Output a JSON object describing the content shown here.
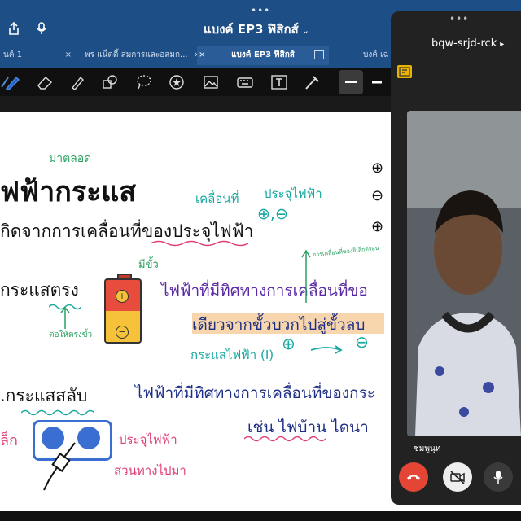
{
  "header": {
    "title": "แบงค์ EP3 ฟิสิกส์",
    "dots": "•••"
  },
  "tabs": [
    {
      "label": "นค์ 1",
      "close": "×"
    },
    {
      "label": "พร แน็ตตี้ สมการและอสมก...",
      "close": "×"
    },
    {
      "label": "แบงค์ EP3 ฟิสิกส์",
      "close": "×"
    },
    {
      "label": "บงค์ เฉ",
      "close": ""
    }
  ],
  "toolbar": {
    "tools": [
      "lasso-icon",
      "pen-icon",
      "eraser-icon",
      "highlighter-icon",
      "shapes-icon",
      "lasso-select-icon",
      "sticker-icon",
      "image-icon",
      "keyboard-icon",
      "text-icon",
      "pointer-icon",
      "thin-line-icon",
      "thick-line-icon"
    ]
  },
  "notes": {
    "title_small": "มาตลอด",
    "title": "ฟฟ้ากระแส",
    "line1": "กิดจากการเคลื่อนที่ของประจุไฟฟ้า",
    "moving": "เคลื่อนที่",
    "charge": "ประจุไฟฟ้า",
    "charge_signs": "⊕,⊖",
    "dc_heading": "กระแสตรง",
    "has_poles": "มีขั้ว",
    "connect_poles": "ต่อให้ตรงขั้ว",
    "dc_desc": "ไฟฟ้าที่มีทิศทางการเคลื่อนที่ขอ",
    "one_direction": "เดียวจากขั้วบวกไปสู่ขั้วลบ",
    "current_label": "กระแสไฟฟ้า (I)",
    "plus_circle": "⊕",
    "minus_circle": "⊖",
    "right_signs": [
      "⊕",
      "⊖",
      "⊕"
    ],
    "small_green": "การเคลื่อนที่ของอิเล็กตรอน",
    "ac_heading": ".กระแสสลับ",
    "ac_desc": "ไฟฟ้าที่มีทิศทางการเคลื่อนที่ของกระ",
    "ac_example": "เช่น ไฟบ้าน   ไดนา",
    "ac_charge": "ประจุไฟฟ้า",
    "ac_back_forth": "ส่วนทางไปมา",
    "left_cut": "ล็ก",
    "battery_plus": "+",
    "battery_minus": "−"
  },
  "meet": {
    "dots": "•••",
    "code": "bqw-srjd-rck",
    "code_arrow": "▸",
    "participant_name": "ชมพูนุท",
    "controls": [
      "end-call-icon",
      "camera-off-icon",
      "microphone-icon"
    ]
  },
  "colors": {
    "top": "#1e4e86",
    "pink": "#e0407a",
    "purple": "#5a2aa5",
    "navy": "#1e2f86",
    "teal": "#18a8a0",
    "green": "#2aa060",
    "orange_highlight": "#f5c58a",
    "end_call": "#e54535"
  }
}
